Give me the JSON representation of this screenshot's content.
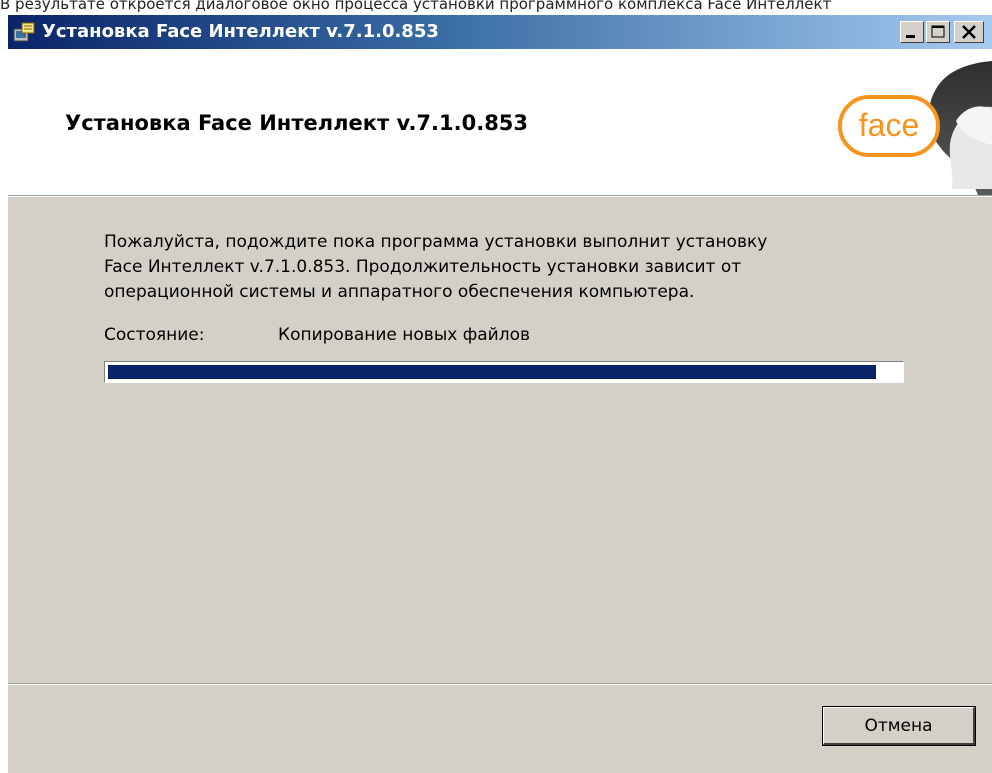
{
  "document_caption": "В результате откроется диалоговое окно процесса установки программного комплекса Face Интеллект",
  "window": {
    "title": "Установка Face Интеллект v.7.1.0.853",
    "controls": [
      "minimize-icon",
      "maximize-icon",
      "close-icon"
    ]
  },
  "banner": {
    "title": "Установка Face Интеллект v.7.1.0.853",
    "logo_text": "face",
    "logo_color": "#f7941d"
  },
  "content": {
    "description_lines": [
      "Пожалуйста, подождите пока программа установки выполнит установку",
      "Face Интеллект v.7.1.0.853. Продолжительность установки зависит от",
      "операционной системы и аппаратного обеспечения компьютера."
    ],
    "status_label": "Состояние:",
    "status_value": "Копирование новых файлов",
    "progress_percent": 97
  },
  "footer": {
    "cancel_label": "Отмена"
  },
  "colors": {
    "titlebar_start": "#0a246a",
    "progress_fill": "#0a246a",
    "dialog_background": "#d4d0c8"
  }
}
